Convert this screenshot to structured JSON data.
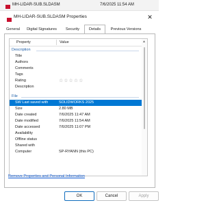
{
  "file_row": {
    "name": "MH-LIDAR-SUB.SLDASM",
    "date": "7/6/2025 11:54 AM"
  },
  "dialog": {
    "title": "MH-LIDAR-SUB.SLDASM Properties",
    "close_glyph": "✕"
  },
  "tabs": [
    {
      "label": "General"
    },
    {
      "label": "Digital Signatures"
    },
    {
      "label": "Security"
    },
    {
      "label": "Details"
    },
    {
      "label": "Previous Versions"
    }
  ],
  "active_tab": "Details",
  "columns": {
    "property": "Property",
    "value": "Value"
  },
  "groups": {
    "description": "Description",
    "file": "File"
  },
  "description_props": [
    {
      "key": "Title",
      "value": ""
    },
    {
      "key": "Authors",
      "value": ""
    },
    {
      "key": "Comments",
      "value": ""
    },
    {
      "key": "Tags",
      "value": ""
    },
    {
      "key": "Rating",
      "value": "☆☆☆☆☆",
      "rating": 0
    },
    {
      "key": "Description",
      "value": ""
    }
  ],
  "file_props": [
    {
      "key": "SW Last saved with",
      "value": "SOLIDWORKS 2025",
      "selected": true
    },
    {
      "key": "Size",
      "value": "2.80 MB"
    },
    {
      "key": "Date created",
      "value": "7/6/2025 11:47 AM"
    },
    {
      "key": "Date modified",
      "value": "7/6/2025 11:54 AM"
    },
    {
      "key": "Date accessed",
      "value": "7/6/2025 11:07 PM"
    },
    {
      "key": "Availability",
      "value": ""
    },
    {
      "key": "Offline status",
      "value": ""
    },
    {
      "key": "Shared with",
      "value": ""
    },
    {
      "key": "Computer",
      "value": "SP-RYANN (this PC)"
    }
  ],
  "remove_link": "Remove Properties and Personal Information",
  "buttons": {
    "ok": "OK",
    "cancel": "Cancel",
    "apply": "Apply"
  },
  "colors": {
    "accent": "#0078d4",
    "group_text": "#1f5fa8",
    "link": "#0b57d0"
  }
}
